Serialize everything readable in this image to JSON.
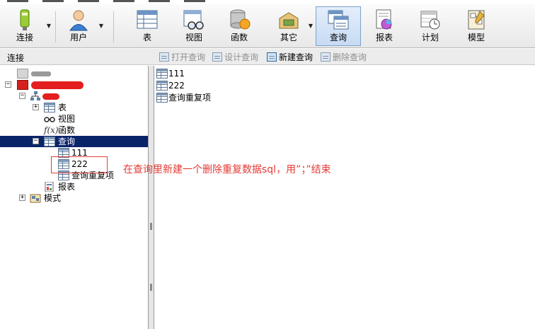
{
  "toolbar": {
    "buttons": [
      {
        "label": "连接",
        "icon": "plug-icon"
      },
      {
        "label": "用户",
        "icon": "user-icon"
      },
      {
        "label": "表",
        "icon": "table-icon"
      },
      {
        "label": "视图",
        "icon": "view-icon"
      },
      {
        "label": "函数",
        "icon": "function-icon"
      },
      {
        "label": "其它",
        "icon": "other-icon"
      },
      {
        "label": "查询",
        "icon": "query-icon"
      },
      {
        "label": "报表",
        "icon": "report-icon"
      },
      {
        "label": "计划",
        "icon": "schedule-icon"
      },
      {
        "label": "模型",
        "icon": "model-icon"
      }
    ],
    "active": "查询"
  },
  "subbar": {
    "title": "连接",
    "actions": [
      {
        "label": "打开查询",
        "enabled": false
      },
      {
        "label": "设计查询",
        "enabled": false
      },
      {
        "label": "新建查询",
        "enabled": true
      },
      {
        "label": "删除查询",
        "enabled": false
      }
    ]
  },
  "tree": {
    "nodes": [
      {
        "label": "表"
      },
      {
        "label": "视图"
      },
      {
        "label": "函数"
      },
      {
        "label": "查询"
      },
      {
        "label": "111"
      },
      {
        "label": "222"
      },
      {
        "label": "查询重复项"
      },
      {
        "label": "报表"
      },
      {
        "label": "模式"
      }
    ]
  },
  "content": {
    "items": [
      "111",
      "222",
      "查询重复项"
    ]
  },
  "annotation": {
    "text": "在查询里新建一个删除重复数据sql，用”；”结束"
  },
  "colors": {
    "selection": "#0a246a",
    "annotation": "#e43a34",
    "active_button": "#c7dbf3"
  }
}
